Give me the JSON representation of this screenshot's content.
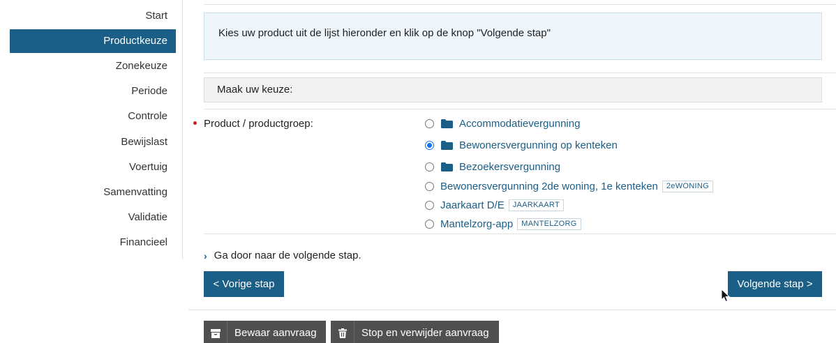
{
  "sidebar": {
    "items": [
      {
        "label": "Start"
      },
      {
        "label": "Productkeuze"
      },
      {
        "label": "Zonekeuze"
      },
      {
        "label": "Periode"
      },
      {
        "label": "Controle"
      },
      {
        "label": "Bewijslast"
      },
      {
        "label": "Voertuig"
      },
      {
        "label": "Samenvatting"
      },
      {
        "label": "Validatie"
      },
      {
        "label": "Financieel"
      }
    ],
    "active_index": 1
  },
  "main": {
    "instruction": "Kies uw product uit de lijst hieronder en klik op de knop \"Volgende stap\"",
    "choose_heading": "Maak uw keuze:",
    "field_label": "Product / productgroep:",
    "options": [
      {
        "label": "Accommodatievergunning",
        "folder": true,
        "checked": false,
        "badge": ""
      },
      {
        "label": "Bewonersvergunning op kenteken",
        "folder": true,
        "checked": true,
        "badge": ""
      },
      {
        "label": "Bezoekersvergunning",
        "folder": true,
        "checked": false,
        "badge": ""
      },
      {
        "label": "Bewonersvergunning 2de woning, 1e kenteken",
        "folder": false,
        "checked": false,
        "badge": "2eWONING"
      },
      {
        "label": "Jaarkaart D/E",
        "folder": false,
        "checked": false,
        "badge": "JAARKAART"
      },
      {
        "label": "Mantelzorg-app",
        "folder": false,
        "checked": false,
        "badge": "MANTELZORG"
      }
    ],
    "goto_text": "Ga door naar de volgende stap.",
    "prev_label": "< Vorige stap",
    "next_label": "Volgende stap >",
    "save_label": "Bewaar aanvraag",
    "stop_label": "Stop en verwijder aanvraag"
  },
  "colors": {
    "accent": "#1b5e86",
    "info_bg": "#eef6fc",
    "required": "#cc1f1f",
    "dark_button": "#505050"
  },
  "icons": {
    "folder": "folder-icon",
    "archive": "archive-icon",
    "trash": "trash-icon",
    "chevron": "chevron-right-icon"
  }
}
